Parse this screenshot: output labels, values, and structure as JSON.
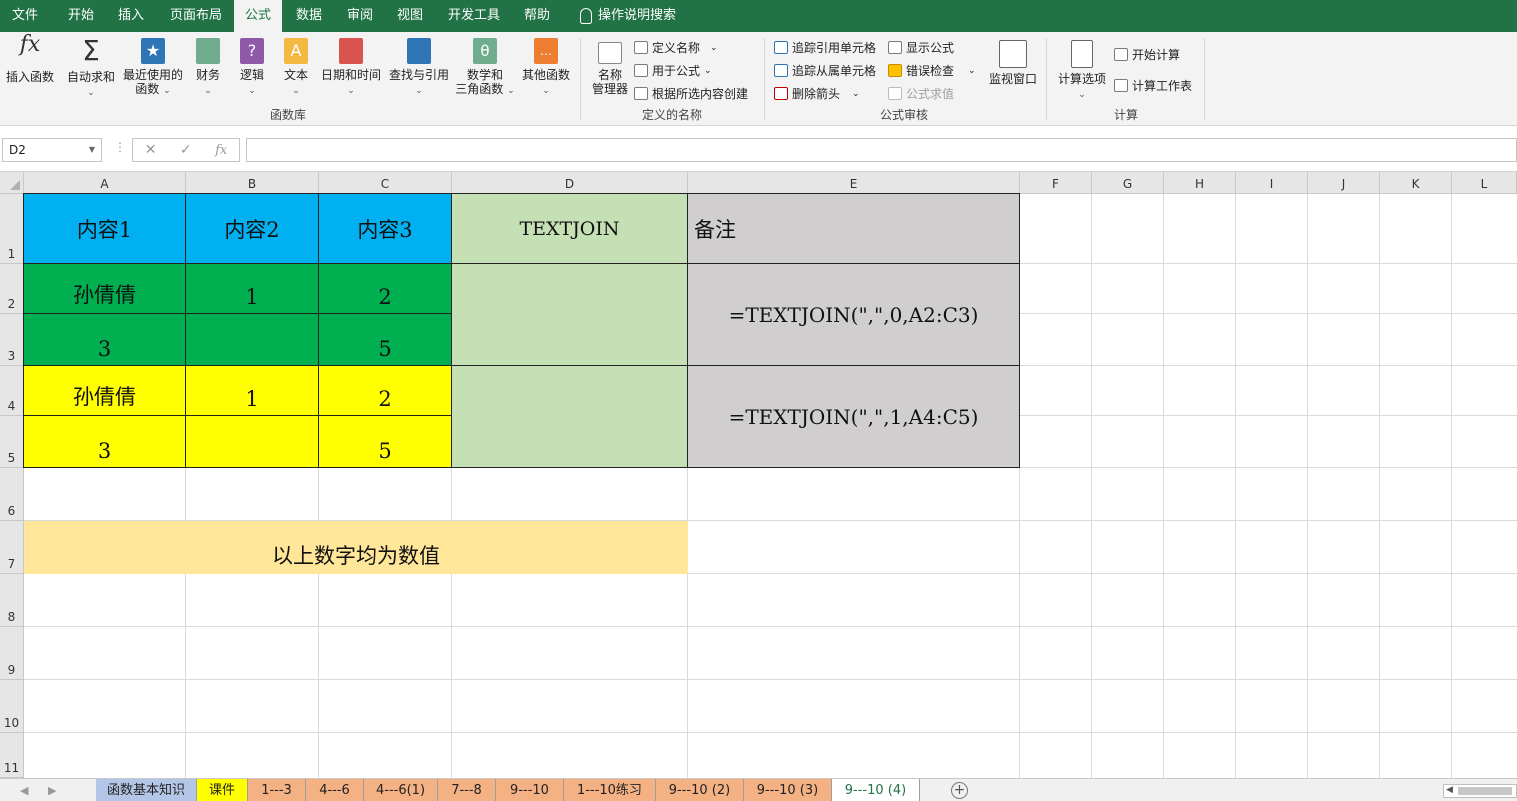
{
  "menu_tabs": [
    "文件",
    "开始",
    "插入",
    "页面布局",
    "公式",
    "数据",
    "审阅",
    "视图",
    "开发工具",
    "帮助",
    "操作说明搜索"
  ],
  "active_tab": "公式",
  "ribbon": {
    "function_library": {
      "label": "函数库",
      "buttons": [
        "插入函数",
        "自动求和",
        "最近使用的",
        "函数",
        "财务",
        "逻辑",
        "文本",
        "日期和时间",
        "查找与引用",
        "数学和",
        "三角函数",
        "其他函数"
      ]
    },
    "defined_names": {
      "label": "定义的名称",
      "name_manager": [
        "名称",
        "管理器"
      ],
      "items": [
        "定义名称",
        "用于公式",
        "根据所选内容创建"
      ]
    },
    "formula_auditing": {
      "label": "公式审核",
      "items": [
        "追踪引用单元格",
        "追踪从属单元格",
        "删除箭头",
        "显示公式",
        "错误检查",
        "公式求值"
      ],
      "watch_window": "监视窗口"
    },
    "calculation": {
      "label": "计算",
      "options": "计算选项",
      "items": [
        "开始计算",
        "计算工作表"
      ]
    }
  },
  "formula_bar": {
    "name_box": "D2",
    "fx": "fx",
    "cancel": "✕",
    "enter": "✓",
    "content": ""
  },
  "columns": [
    "A",
    "B",
    "C",
    "D",
    "E",
    "F",
    "G",
    "H",
    "I",
    "J",
    "K",
    "L"
  ],
  "rows": [
    "1",
    "2",
    "3",
    "4",
    "5",
    "6",
    "7",
    "8",
    "9",
    "10",
    "11"
  ],
  "cells": {
    "A1": "内容1",
    "B1": "内容2",
    "C1": "内容3",
    "D1": "TEXTJOIN",
    "E1": "备注",
    "A2": "孙倩倩",
    "B2": "1",
    "C2": "2",
    "A3": "3",
    "B3": "",
    "C3": "5",
    "A4": "孙倩倩",
    "B4": "1",
    "C4": "2",
    "A5": "3",
    "B5": "",
    "C5": "5",
    "E2": "=TEXTJOIN(\",\",0,A2:C3)",
    "E4": "=TEXTJOIN(\",\",1,A4:C5)",
    "A7": "以上数字均为数值"
  },
  "fill_colors": {
    "header_blue": "#00b0f0",
    "green": "#00b050",
    "yellow": "#ffff00",
    "light_green": "#c5e0b4",
    "gray": "#d0cece",
    "note_orange": "#ffe699",
    "excel_green": "#217346"
  },
  "sheet_tabs": [
    {
      "name": "函数基本知识",
      "color": "#b4c6e7"
    },
    {
      "name": "课件",
      "color": "#ffff00"
    },
    {
      "name": "1---3",
      "color": "#f4b183"
    },
    {
      "name": "4---6",
      "color": "#f4b183"
    },
    {
      "name": "4---6(1)",
      "color": "#f4b183"
    },
    {
      "name": "7---8",
      "color": "#f4b183"
    },
    {
      "name": "9---10",
      "color": "#f4b183"
    },
    {
      "name": "1---10练习",
      "color": "#f4b183"
    },
    {
      "name": "9---10 (2)",
      "color": "#f4b183"
    },
    {
      "name": "9---10 (3)",
      "color": "#f4b183"
    },
    {
      "name": "9---10 (4)",
      "color": "#ffffff"
    }
  ],
  "active_sheet": "9---10 (4)"
}
